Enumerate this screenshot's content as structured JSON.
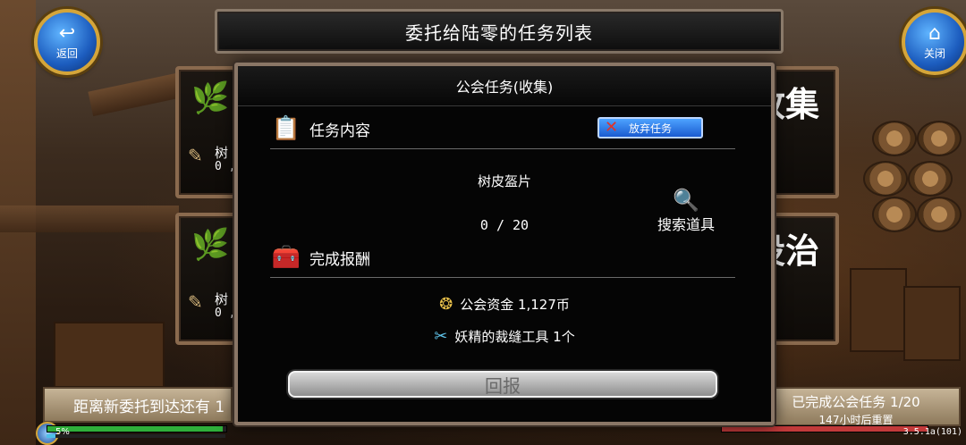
{
  "header": {
    "title": "委托给陆零的任务列表",
    "back_label": "返回",
    "close_label": "关闭"
  },
  "background_cards": [
    {
      "name_partial": "树",
      "progress_partial": "0 ,",
      "big_text": "收集"
    },
    {
      "name_partial": "树",
      "progress_partial": "0 ,",
      "big_text": "设治"
    }
  ],
  "dialog": {
    "title": "公会任务(收集)",
    "content_label": "任务内容",
    "abandon_label": "放弃任务",
    "item_name": "树皮盔片",
    "item_progress": "0 / 20",
    "search_label": "搜索道具",
    "reward_label": "完成报酬",
    "rewards": [
      {
        "icon": "coin-icon",
        "text": "公会资金 1,127币"
      },
      {
        "icon": "needle-icon",
        "text": "妖精的裁缝工具 1个"
      }
    ],
    "report_label": "回报"
  },
  "footer": {
    "left_text": "距离新委托到达还有 1",
    "right_line1": "已完成公会任务  1/20",
    "right_line2": "147小时后重置",
    "percent": "5%",
    "version": "3.5.1a(101)",
    "hp_fraction": 0.98,
    "xp_fraction": 0.05
  }
}
